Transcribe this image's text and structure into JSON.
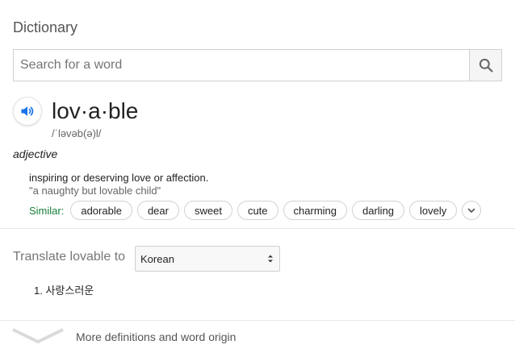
{
  "header": {
    "title": "Dictionary"
  },
  "search": {
    "placeholder": "Search for a word",
    "value": ""
  },
  "entry": {
    "word": "lov·a·ble",
    "phonetic": "/ˈləvəb(ə)l/",
    "part_of_speech": "adjective",
    "definition": "inspiring or deserving love or affection.",
    "example": "\"a naughty but lovable child\"",
    "similar_label": "Similar:",
    "similar": [
      "adorable",
      "dear",
      "sweet",
      "cute",
      "charming",
      "darling",
      "lovely"
    ]
  },
  "translate": {
    "label": "Translate lovable to",
    "language": "Korean",
    "results": [
      "1. 사랑스러운"
    ]
  },
  "footer": {
    "more_label": "More definitions and word origin"
  },
  "colors": {
    "accent_blue": "#1a73e8",
    "similar_green": "#188038"
  }
}
